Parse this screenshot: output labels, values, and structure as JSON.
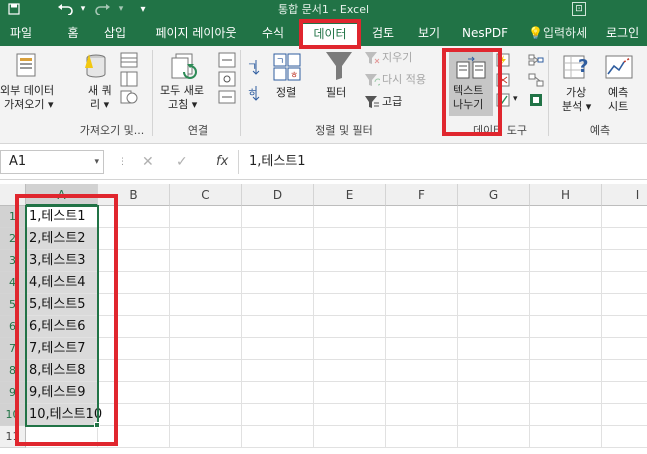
{
  "window": {
    "title": "통합 문서1 - Excel",
    "save_icon": "save-icon",
    "undo_icon": "undo-icon",
    "redo_icon": "redo-icon"
  },
  "tabs": [
    {
      "label": "파일"
    },
    {
      "label": "홈"
    },
    {
      "label": "삽입"
    },
    {
      "label": "페이지 레이아웃"
    },
    {
      "label": "수식"
    },
    {
      "label": "데이터",
      "active": true
    },
    {
      "label": "검토"
    },
    {
      "label": "보기"
    },
    {
      "label": "NesPDF"
    }
  ],
  "tell_me": "입력하세",
  "login": "로그인",
  "ribbon": {
    "get_external": {
      "line1": "외부 데이터",
      "line2": "가져오기 ▾"
    },
    "new_query": {
      "line1": "새 쿼",
      "line2": "리 ▾"
    },
    "group_get_transform": "가져오기 및...",
    "refresh_all": {
      "line1": "모두 새로",
      "line2": "고침 ▾"
    },
    "group_connections": "연결",
    "sort": "정렬",
    "filter": "필터",
    "clear": "지우기",
    "reapply": "다시 적용",
    "advanced": "고급",
    "group_sort_filter": "정렬 및 필터",
    "text_to_columns": {
      "line1": "텍스트",
      "line2": "나누기"
    },
    "group_data_tools": "데이터 도구",
    "what_if": {
      "line1": "가상",
      "line2": "분석 ▾"
    },
    "forecast_sheet": {
      "line1": "예측",
      "line2": "시트"
    },
    "group_forecast": "예측",
    "sort_az": "공",
    "sort_za": "흑",
    "sort_label_a": "공",
    "sort_label_b": "ㅎ"
  },
  "formula_bar": {
    "name_box": "A1",
    "cancel_glyph": "✕",
    "enter_glyph": "✓",
    "fx_label": "fx",
    "content": "1,테스트1"
  },
  "columns": [
    "A",
    "B",
    "C",
    "D",
    "E",
    "F",
    "G",
    "H",
    "I"
  ],
  "rows": [
    "1",
    "2",
    "3",
    "4",
    "5",
    "6",
    "7",
    "8",
    "9",
    "10",
    "11"
  ],
  "cells_a": [
    "1,테스트1",
    "2,테스트2",
    "3,테스트3",
    "4,테스트4",
    "5,테스트5",
    "6,테스트6",
    "7,테스트7",
    "8,테스트8",
    "9,테스트9",
    "10,테스트10"
  ],
  "colors": {
    "accent": "#217346",
    "annotation": "#e0262e"
  }
}
